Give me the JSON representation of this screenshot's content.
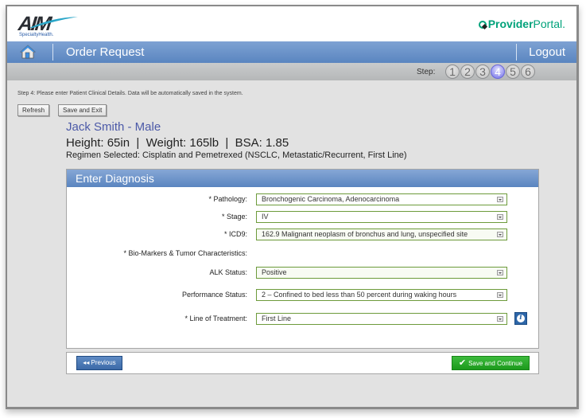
{
  "branding": {
    "logo_main": "AIM",
    "logo_sub": "SpecialtyHealth.",
    "portal_bold": "Provider",
    "portal_light": "Portal."
  },
  "nav": {
    "title": "Order Request",
    "logout_label": "Logout"
  },
  "steps": {
    "label": "Step:",
    "items": [
      "1",
      "2",
      "3",
      "4",
      "5",
      "6"
    ],
    "current": 4
  },
  "page": {
    "instructions": "Step 4: Please enter Patient Clinical Details. Data will be automatically saved in the system.",
    "refresh_label": "Refresh",
    "save_exit_label": "Save and Exit"
  },
  "patient": {
    "name_line": "Jack Smith - Male",
    "vitals_line": "Height: 65in  |  Weight: 165lb  |  BSA: 1.85",
    "regimen_line": "Regimen Selected: Cisplatin and Pemetrexed (NSCLC, Metastatic/Recurrent, First Line)"
  },
  "diagnosis": {
    "title": "Enter Diagnosis",
    "fields": [
      {
        "label": "* Pathology:",
        "value": "Bronchogenic Carcinoma, Adenocarcinoma"
      },
      {
        "label": "* Stage:",
        "value": "IV"
      },
      {
        "label": "* ICD9:",
        "value": "162.9 Malignant neoplasm of bronchus and lung, unspecified site"
      },
      {
        "label": "* Bio-Markers & Tumor Characteristics:"
      },
      {
        "label": "ALK Status:",
        "value": "Positive"
      },
      {
        "label": "Performance Status:",
        "value": "2 – Confined to bed less than 50 percent during waking hours"
      },
      {
        "label": "* Line of Treatment:",
        "value": "First Line"
      }
    ],
    "info_glyph": "i"
  },
  "footer": {
    "previous_label": "◂◂ Previous",
    "save_continue_label": "Save and Continue",
    "check_glyph": "✔"
  },
  "colors": {
    "nav_blue": "#5a85c0",
    "portal_green": "#00a27a",
    "active_step": "#6f6de8",
    "save_green": "#1c9a1c",
    "field_border": "#6d9b3b",
    "patient_name": "#4c5aa8"
  }
}
